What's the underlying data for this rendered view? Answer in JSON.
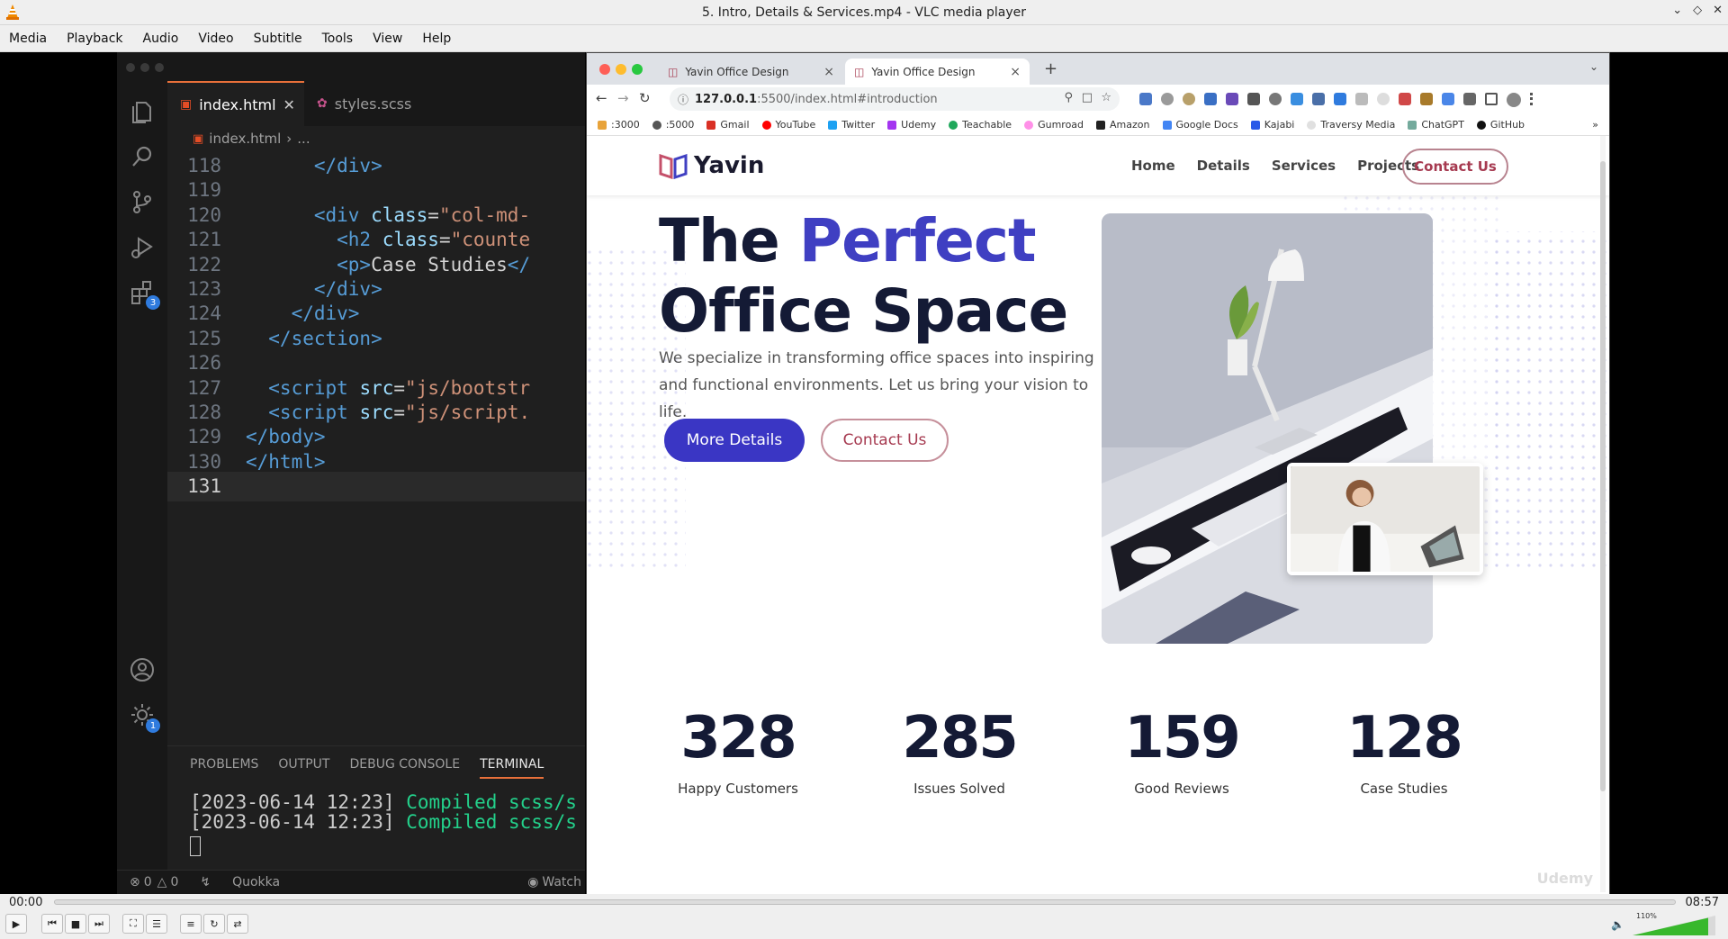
{
  "window": {
    "title": "5. Intro, Details & Services.mp4 - VLC media player"
  },
  "menu": [
    "Media",
    "Playback",
    "Audio",
    "Video",
    "Subtitle",
    "Tools",
    "View",
    "Help"
  ],
  "vscode": {
    "tabs": [
      {
        "label": "index.html",
        "active": true
      },
      {
        "label": "styles.scss",
        "active": false
      }
    ],
    "breadcrumb": {
      "file": "index.html",
      "rest": "..."
    },
    "activity_badges": {
      "extensions": "3",
      "settings": "1"
    },
    "code_lines": [
      {
        "n": "118",
        "text": "      </div>"
      },
      {
        "n": "119",
        "text": ""
      },
      {
        "n": "120",
        "text": "      <div class=\"col-md-"
      },
      {
        "n": "121",
        "text": "        <h2 class=\"counte"
      },
      {
        "n": "122",
        "text": "        <p>Case Studies</"
      },
      {
        "n": "123",
        "text": "      </div>"
      },
      {
        "n": "124",
        "text": "    </div>"
      },
      {
        "n": "125",
        "text": "  </section>"
      },
      {
        "n": "126",
        "text": ""
      },
      {
        "n": "127",
        "text": "  <script src=\"js/bootstr"
      },
      {
        "n": "128",
        "text": "  <script src=\"js/script."
      },
      {
        "n": "129",
        "text": "</body>"
      },
      {
        "n": "130",
        "text": "</html>"
      },
      {
        "n": "131",
        "text": ""
      }
    ],
    "panel_tabs": [
      "PROBLEMS",
      "OUTPUT",
      "DEBUG CONSOLE",
      "TERMINAL"
    ],
    "terminal": [
      {
        "ts": "[2023-06-14 12:23]",
        "msg": "Compiled scss/s"
      },
      {
        "ts": "[2023-06-14 12:23]",
        "msg": "Compiled scss/s"
      }
    ],
    "status": {
      "errors": "0",
      "warnings": "0",
      "extension": "Quokka",
      "watch": "Watch"
    }
  },
  "browser": {
    "tabs": [
      {
        "label": "Yavin Office Design",
        "active": false
      },
      {
        "label": "Yavin Office Design",
        "active": true
      }
    ],
    "url_host": "127.0.0.1",
    "url_path": ":5500/index.html#introduction",
    "bookmarks": [
      ":3000",
      ":5000",
      "Gmail",
      "YouTube",
      "Twitter",
      "Udemy",
      "Teachable",
      "Gumroad",
      "Amazon",
      "Google Docs",
      "Kajabi",
      "Traversy Media",
      "ChatGPT",
      "GitHub"
    ]
  },
  "site": {
    "logo": "Yavin",
    "nav": [
      "Home",
      "Details",
      "Services",
      "Projects"
    ],
    "nav_cta": "Contact Us",
    "hero": {
      "title_line1_plain": "The ",
      "title_line1_accent": "Perfect",
      "title_line2": "Office Space",
      "subtitle": "We specialize in transforming office spaces into inspiring and functional environments. Let us bring your vision to life.",
      "primary_button": "More Details",
      "secondary_button": "Contact Us"
    },
    "stats": [
      {
        "value": "328",
        "label": "Happy Customers"
      },
      {
        "value": "285",
        "label": "Issues Solved"
      },
      {
        "value": "159",
        "label": "Good Reviews"
      },
      {
        "value": "128",
        "label": "Case Studies"
      }
    ],
    "watermark": "Udemy"
  },
  "player": {
    "time_elapsed": "00:00",
    "time_total": "08:57",
    "volume": "110%"
  },
  "colors": {
    "accent_blue": "#3a36c4",
    "accent_rose": "#a63a50",
    "vscode_bg": "#1f1f1f"
  }
}
